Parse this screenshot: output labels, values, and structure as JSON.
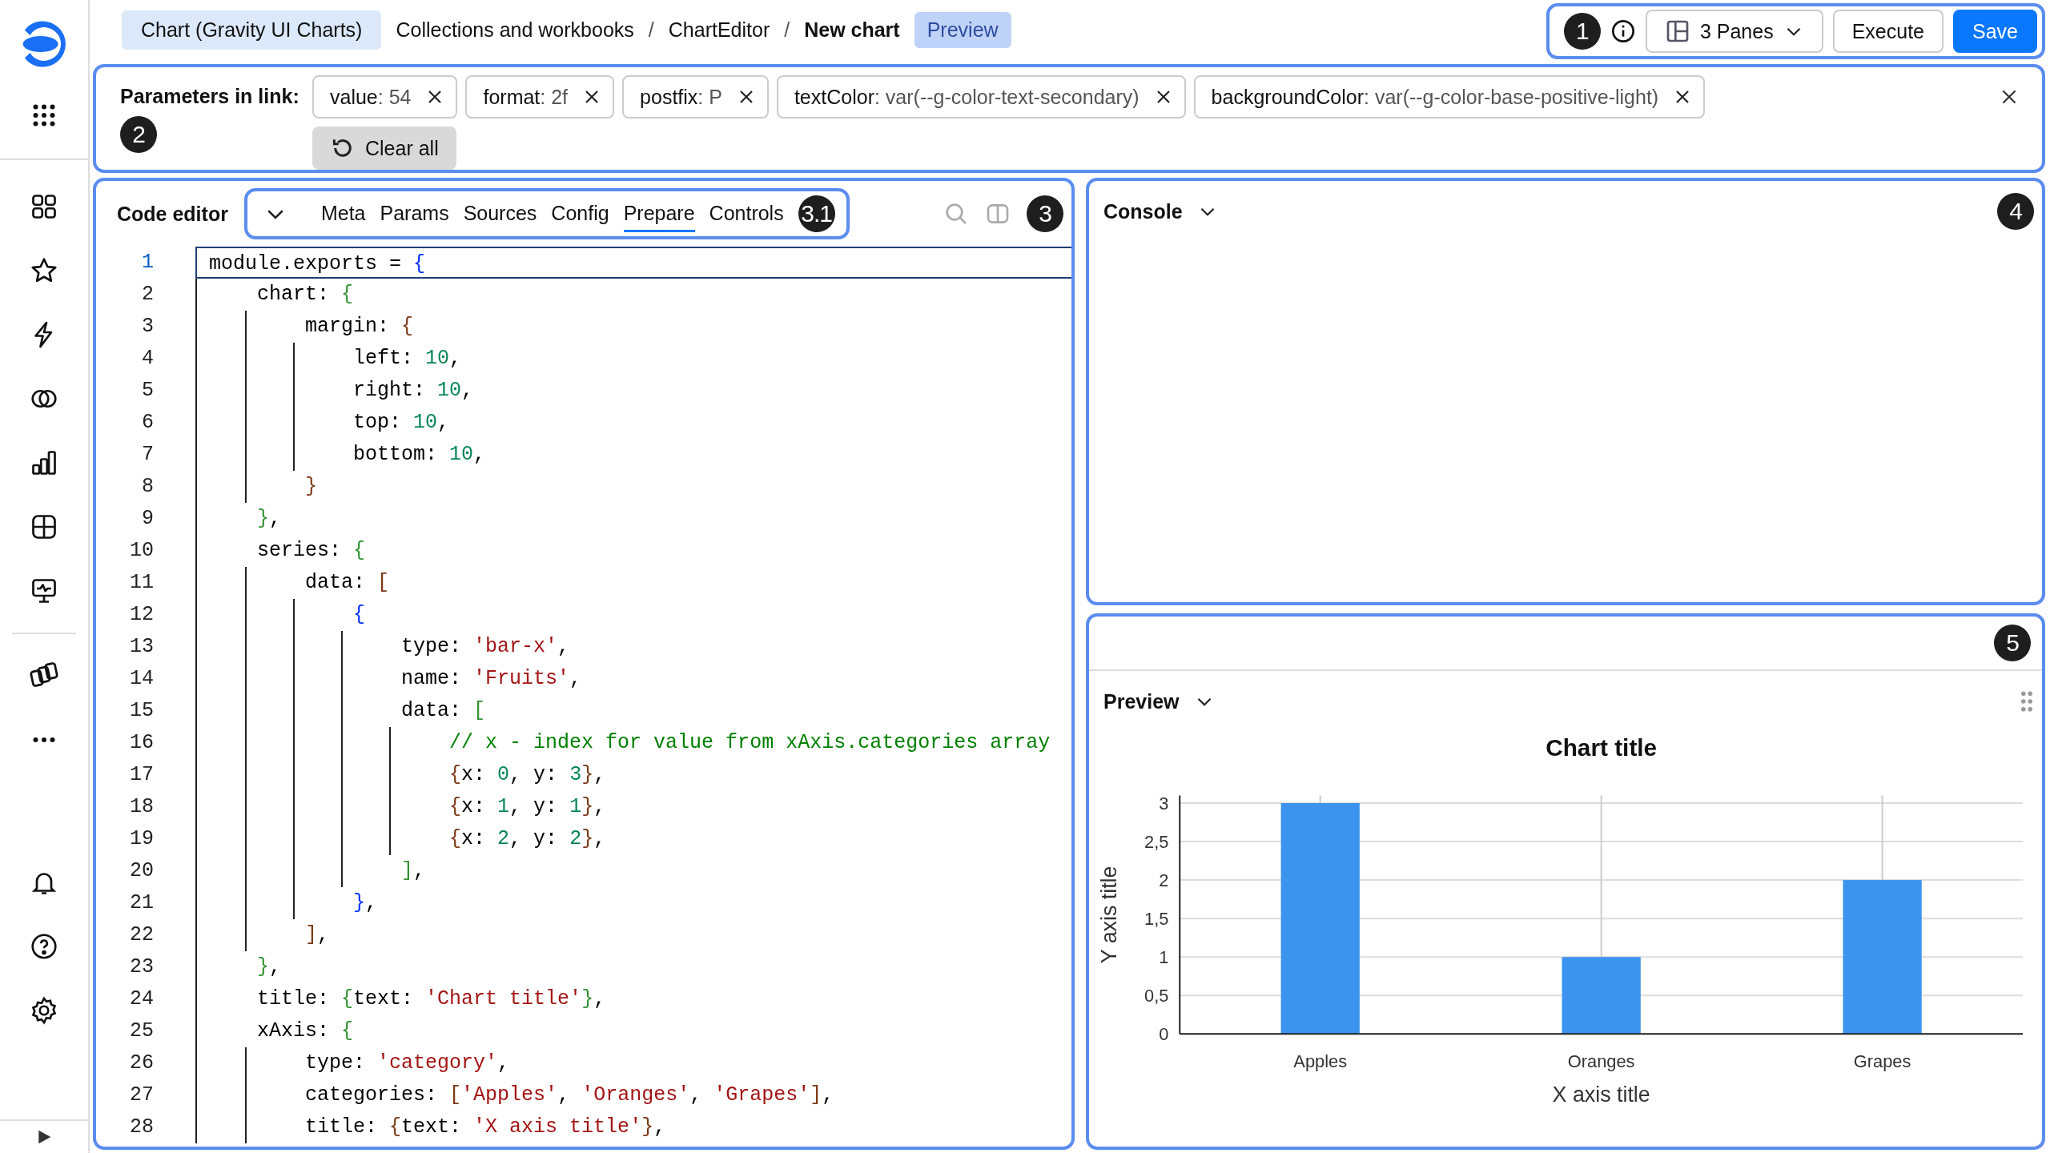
{
  "breadcrumbs": {
    "chart_type": "Chart (Gravity UI Charts)",
    "path": [
      {
        "label": "Collections and workbooks",
        "current": false
      },
      {
        "label": "ChartEditor",
        "current": false
      },
      {
        "label": "New chart",
        "current": true
      }
    ],
    "separator": "/",
    "mode_badge": "Preview"
  },
  "toolbar": {
    "callout": "1",
    "panes": "3 Panes",
    "execute": "Execute",
    "save": "Save"
  },
  "parameters": {
    "title": "Parameters in link:",
    "callout": "2",
    "chips": [
      {
        "key": "value",
        "sep": ":",
        "value": "54"
      },
      {
        "key": "format",
        "sep": ":",
        "value": "2f"
      },
      {
        "key": "postfix",
        "sep": ":",
        "value": "P"
      },
      {
        "key": "textColor",
        "sep": ":",
        "value": "var(--g-color-text-secondary)"
      },
      {
        "key": "backgroundColor",
        "sep": ":",
        "value": "var(--g-color-base-positive-light)"
      }
    ],
    "clear_all": "Clear all"
  },
  "code_editor": {
    "title": "Code editor",
    "callout": "3",
    "tabs_callout": "3.1",
    "tabs": [
      {
        "label": "Meta",
        "selected": false
      },
      {
        "label": "Params",
        "selected": false
      },
      {
        "label": "Sources",
        "selected": false
      },
      {
        "label": "Config",
        "selected": false
      },
      {
        "label": "Prepare",
        "selected": true
      },
      {
        "label": "Controls",
        "selected": false
      }
    ],
    "lines": [
      {
        "number": "1",
        "current": true,
        "tokens": [
          {
            "text": "module.exports = ",
            "kind": "plain"
          },
          {
            "text": "{",
            "kind": "b1"
          }
        ]
      },
      {
        "number": "2",
        "current": false,
        "tokens": [
          {
            "text": "    chart: ",
            "kind": "plain"
          },
          {
            "text": "{",
            "kind": "b2"
          }
        ]
      },
      {
        "number": "3",
        "current": false,
        "tokens": [
          {
            "text": "        margin: ",
            "kind": "plain"
          },
          {
            "text": "{",
            "kind": "b3"
          }
        ]
      },
      {
        "number": "4",
        "current": false,
        "tokens": [
          {
            "text": "            left: ",
            "kind": "plain"
          },
          {
            "text": "10",
            "kind": "num"
          },
          {
            "text": ",",
            "kind": "plain"
          }
        ]
      },
      {
        "number": "5",
        "current": false,
        "tokens": [
          {
            "text": "            right: ",
            "kind": "plain"
          },
          {
            "text": "10",
            "kind": "num"
          },
          {
            "text": ",",
            "kind": "plain"
          }
        ]
      },
      {
        "number": "6",
        "current": false,
        "tokens": [
          {
            "text": "            top: ",
            "kind": "plain"
          },
          {
            "text": "10",
            "kind": "num"
          },
          {
            "text": ",",
            "kind": "plain"
          }
        ]
      },
      {
        "number": "7",
        "current": false,
        "tokens": [
          {
            "text": "            bottom: ",
            "kind": "plain"
          },
          {
            "text": "10",
            "kind": "num"
          },
          {
            "text": ",",
            "kind": "plain"
          }
        ]
      },
      {
        "number": "8",
        "current": false,
        "tokens": [
          {
            "text": "        }",
            "kind": "b3"
          }
        ]
      },
      {
        "number": "9",
        "current": false,
        "tokens": [
          {
            "text": "    }",
            "kind": "b2"
          },
          {
            "text": ",",
            "kind": "plain"
          }
        ]
      },
      {
        "number": "10",
        "current": false,
        "tokens": [
          {
            "text": "    series: ",
            "kind": "plain"
          },
          {
            "text": "{",
            "kind": "b2"
          }
        ]
      },
      {
        "number": "11",
        "current": false,
        "tokens": [
          {
            "text": "        data: ",
            "kind": "plain"
          },
          {
            "text": "[",
            "kind": "b3"
          }
        ]
      },
      {
        "number": "12",
        "current": false,
        "tokens": [
          {
            "text": "            {",
            "kind": "b1"
          }
        ]
      },
      {
        "number": "13",
        "current": false,
        "tokens": [
          {
            "text": "                type: ",
            "kind": "plain"
          },
          {
            "text": "'bar-x'",
            "kind": "str"
          },
          {
            "text": ",",
            "kind": "plain"
          }
        ]
      },
      {
        "number": "14",
        "current": false,
        "tokens": [
          {
            "text": "                name: ",
            "kind": "plain"
          },
          {
            "text": "'Fruits'",
            "kind": "str"
          },
          {
            "text": ",",
            "kind": "plain"
          }
        ]
      },
      {
        "number": "15",
        "current": false,
        "tokens": [
          {
            "text": "                data: ",
            "kind": "plain"
          },
          {
            "text": "[",
            "kind": "b2"
          }
        ]
      },
      {
        "number": "16",
        "current": false,
        "tokens": [
          {
            "text": "                    // x - index for value from xAxis.categories array",
            "kind": "comment"
          }
        ]
      },
      {
        "number": "17",
        "current": false,
        "tokens": [
          {
            "text": "                    {",
            "kind": "b3"
          },
          {
            "text": "x: ",
            "kind": "plain"
          },
          {
            "text": "0",
            "kind": "num"
          },
          {
            "text": ", y: ",
            "kind": "plain"
          },
          {
            "text": "3",
            "kind": "num"
          },
          {
            "text": "}",
            "kind": "b3"
          },
          {
            "text": ",",
            "kind": "plain"
          }
        ]
      },
      {
        "number": "18",
        "current": false,
        "tokens": [
          {
            "text": "                    {",
            "kind": "b3"
          },
          {
            "text": "x: ",
            "kind": "plain"
          },
          {
            "text": "1",
            "kind": "num"
          },
          {
            "text": ", y: ",
            "kind": "plain"
          },
          {
            "text": "1",
            "kind": "num"
          },
          {
            "text": "}",
            "kind": "b3"
          },
          {
            "text": ",",
            "kind": "plain"
          }
        ]
      },
      {
        "number": "19",
        "current": false,
        "tokens": [
          {
            "text": "                    {",
            "kind": "b3"
          },
          {
            "text": "x: ",
            "kind": "plain"
          },
          {
            "text": "2",
            "kind": "num"
          },
          {
            "text": ", y: ",
            "kind": "plain"
          },
          {
            "text": "2",
            "kind": "num"
          },
          {
            "text": "}",
            "kind": "b3"
          },
          {
            "text": ",",
            "kind": "plain"
          }
        ]
      },
      {
        "number": "20",
        "current": false,
        "tokens": [
          {
            "text": "                ]",
            "kind": "b2"
          },
          {
            "text": ",",
            "kind": "plain"
          }
        ]
      },
      {
        "number": "21",
        "current": false,
        "tokens": [
          {
            "text": "            }",
            "kind": "b1"
          },
          {
            "text": ",",
            "kind": "plain"
          }
        ]
      },
      {
        "number": "22",
        "current": false,
        "tokens": [
          {
            "text": "        ]",
            "kind": "b3"
          },
          {
            "text": ",",
            "kind": "plain"
          }
        ]
      },
      {
        "number": "23",
        "current": false,
        "tokens": [
          {
            "text": "    }",
            "kind": "b2"
          },
          {
            "text": ",",
            "kind": "plain"
          }
        ]
      },
      {
        "number": "24",
        "current": false,
        "tokens": [
          {
            "text": "    title: ",
            "kind": "plain"
          },
          {
            "text": "{",
            "kind": "b2"
          },
          {
            "text": "text: ",
            "kind": "plain"
          },
          {
            "text": "'Chart title'",
            "kind": "str"
          },
          {
            "text": "}",
            "kind": "b2"
          },
          {
            "text": ",",
            "kind": "plain"
          }
        ]
      },
      {
        "number": "25",
        "current": false,
        "tokens": [
          {
            "text": "    xAxis: ",
            "kind": "plain"
          },
          {
            "text": "{",
            "kind": "b2"
          }
        ]
      },
      {
        "number": "26",
        "current": false,
        "tokens": [
          {
            "text": "        type: ",
            "kind": "plain"
          },
          {
            "text": "'category'",
            "kind": "str"
          },
          {
            "text": ",",
            "kind": "plain"
          }
        ]
      },
      {
        "number": "27",
        "current": false,
        "tokens": [
          {
            "text": "        categories: ",
            "kind": "plain"
          },
          {
            "text": "[",
            "kind": "b3"
          },
          {
            "text": "'Apples'",
            "kind": "str"
          },
          {
            "text": ", ",
            "kind": "plain"
          },
          {
            "text": "'Oranges'",
            "kind": "str"
          },
          {
            "text": ", ",
            "kind": "plain"
          },
          {
            "text": "'Grapes'",
            "kind": "str"
          },
          {
            "text": "]",
            "kind": "b3"
          },
          {
            "text": ",",
            "kind": "plain"
          }
        ]
      },
      {
        "number": "28",
        "current": false,
        "tokens": [
          {
            "text": "        title: ",
            "kind": "plain"
          },
          {
            "text": "{",
            "kind": "b3"
          },
          {
            "text": "text: ",
            "kind": "plain"
          },
          {
            "text": "'X axis title'",
            "kind": "str"
          },
          {
            "text": "}",
            "kind": "b3"
          },
          {
            "text": ",",
            "kind": "plain"
          }
        ]
      }
    ]
  },
  "console": {
    "title": "Console",
    "callout": "4"
  },
  "preview": {
    "title": "Preview",
    "callout": "5",
    "chart_data": {
      "type": "bar",
      "title": "Chart title",
      "xlabel": "X axis title",
      "ylabel": "Y axis title",
      "categories": [
        "Apples",
        "Oranges",
        "Grapes"
      ],
      "series": [
        {
          "color": "#3c94ee",
          "values": [
            3,
            1,
            2
          ]
        }
      ],
      "ylim": [
        0,
        3.1
      ],
      "grid": true,
      "yticks": [
        {
          "value": 0,
          "label": "0"
        },
        {
          "value": 0.5,
          "label": "0,5"
        },
        {
          "value": 1,
          "label": "1"
        },
        {
          "value": 1.5,
          "label": "1,5"
        },
        {
          "value": 2,
          "label": "2"
        },
        {
          "value": 2.5,
          "label": "2,5"
        },
        {
          "value": 3,
          "label": "3"
        }
      ]
    }
  }
}
